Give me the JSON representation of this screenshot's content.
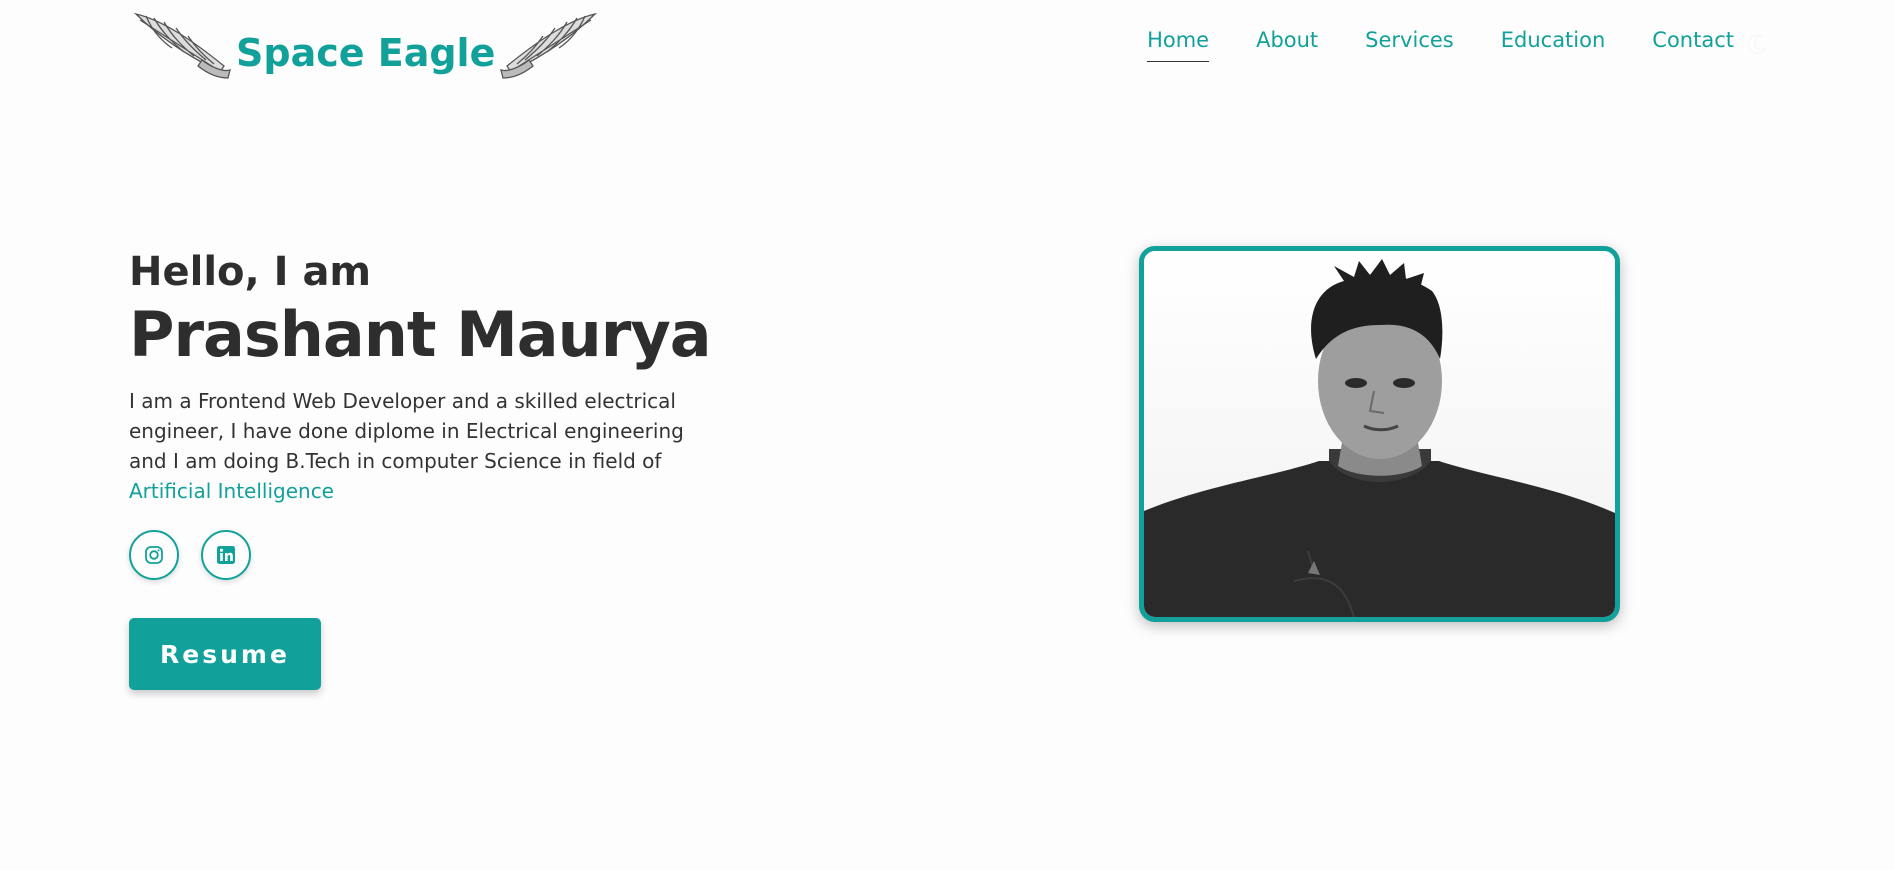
{
  "brand": {
    "name": "Space Eagle",
    "accent": "#12a19a"
  },
  "nav": {
    "items": [
      {
        "label": "Home",
        "active": true
      },
      {
        "label": "About",
        "active": false
      },
      {
        "label": "Services",
        "active": false
      },
      {
        "label": "Education",
        "active": false
      },
      {
        "label": "Contact",
        "active": false
      }
    ],
    "theme_toggle_icon": "moon-icon"
  },
  "hero": {
    "greeting": "Hello, I am",
    "name": "Prashant Maurya",
    "description": "I am a Frontend Web Developer and a skilled electrical engineer, I have done diplome in Electrical engineering and I am doing B.Tech in computer Science in field of",
    "description_highlight": "Artificial Intelligence",
    "socials": [
      {
        "icon": "instagram-icon"
      },
      {
        "icon": "linkedin-icon"
      }
    ],
    "resume_label": "Resume"
  }
}
